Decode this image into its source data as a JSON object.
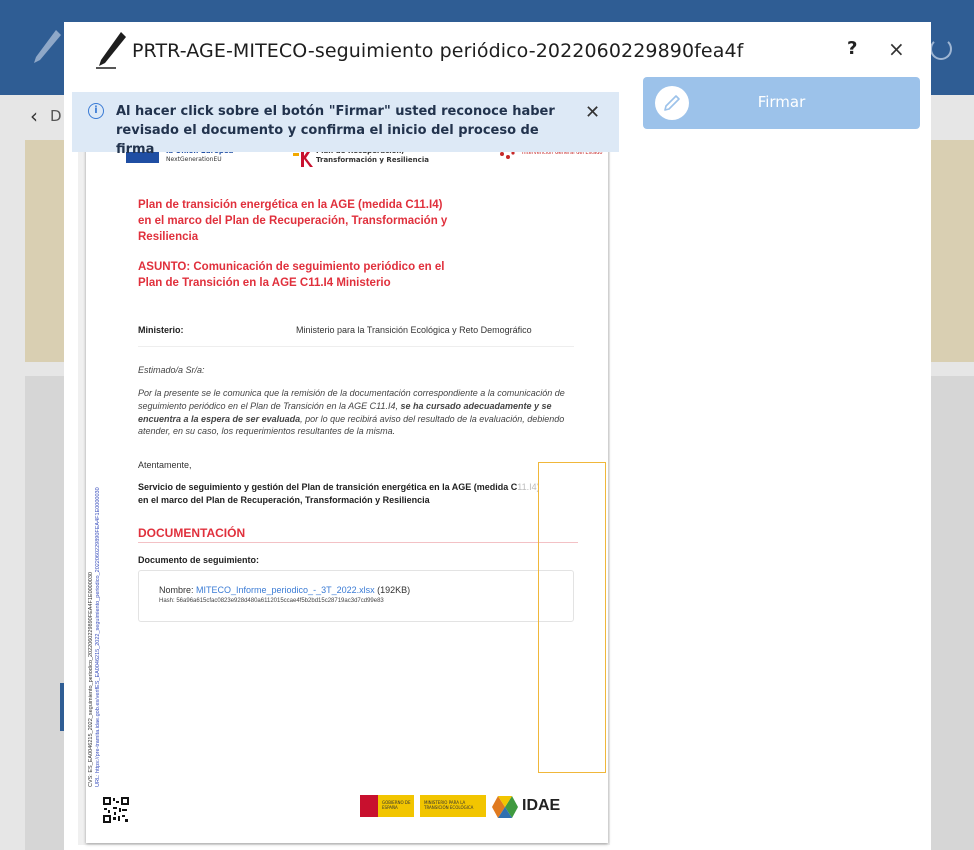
{
  "modal": {
    "title": "PRTR-AGE-MITECO-seguimiento periódico-2022060229890fea4f",
    "help_label": "?",
    "close_label": "×"
  },
  "info_banner": {
    "icon_label": "i",
    "text": "Al hacer click sobre el botón \"Firmar\" usted reconoce haber revisado el documento y confirma el inicio del proceso de firma",
    "close_label": "✕"
  },
  "sign_button": {
    "label": "Firmar"
  },
  "background": {
    "back_label": "‹",
    "back_letter": "D"
  },
  "document": {
    "logos": {
      "eu_title": "la Unión Europea",
      "eu_subtitle": "NextGenerationEU",
      "prtr_title": "Plan de Recuperación,",
      "prtr_subtitle": "Transformación y Resiliencia",
      "minhac_text": "Intervención General del Estado"
    },
    "title_plan": "Plan de transición energética en la AGE (medida C11.I4) en el marco del Plan de Recuperación, Transformación y Resiliencia",
    "title_asunto": "ASUNTO: Comunicación de seguimiento periódico en el Plan de Transición en la AGE C11.I4 Ministerio",
    "ministerio_label": "Ministerio:",
    "ministerio_value": "Ministerio para la Transición Ecológica y Reto Demográfico",
    "greeting": "Estimado/a Sr/a:",
    "body_part1": "Por la presente se le comunica que la remisión de la documentación correspondiente a la comunicación de seguimiento periódico en el Plan de Transición en la AGE C11.I4, ",
    "body_bold": "se ha cursado adecuadamente y se encuentra a la espera de ser evaluada",
    "body_part2": ", por lo que recibirá aviso del resultado de la evaluación, debiendo atender, en su caso, los requerimientos resultantes de la misma.",
    "closing": "Atentamente,",
    "signature_main": "Servicio de seguimiento y gestión del Plan de transición energética en la AGE (medida C",
    "signature_tail": "11.I4)",
    "signature_line2": "en el marco del Plan de Recuperación, Transformación y Resiliencia",
    "doc_heading": "DOCUMENTACIÓN",
    "seg_label": "Documento de seguimiento:",
    "file_prefix": "Nombre: ",
    "file_link": "MITECO_Informe_periodico_-_3T_2022.xlsx",
    "file_size": " (192KB)",
    "file_hash": "Hash: 56a96a615cfac0823e928d480a6112015ccae4f5b2bd15c28719ac3d7cd99e83",
    "stamp_csv": "CVS: ES_EA0046215_2022_seguimiento_periodico_2022060229890FEA4F1E0000030",
    "stamp_url": "URL: https://pre-tramita.idae.gob.es/verifES_EA0046215_2022_seguimiento_periodico_2022060229890FEA4F1E0000030",
    "footer": {
      "gob_text": "GOBIERNO DE ESPAÑA",
      "min_text": "MINISTERIO PARA LA TRANSICIÓN ECOLÓGICA",
      "idae_text": "IDAE"
    }
  },
  "colors": {
    "header_blue": "#2f5d94",
    "accent_red": "#e0303c",
    "sign_button": "#9cc2ea",
    "banner_bg": "#dde9f6",
    "highlight": "#f0b73a"
  }
}
